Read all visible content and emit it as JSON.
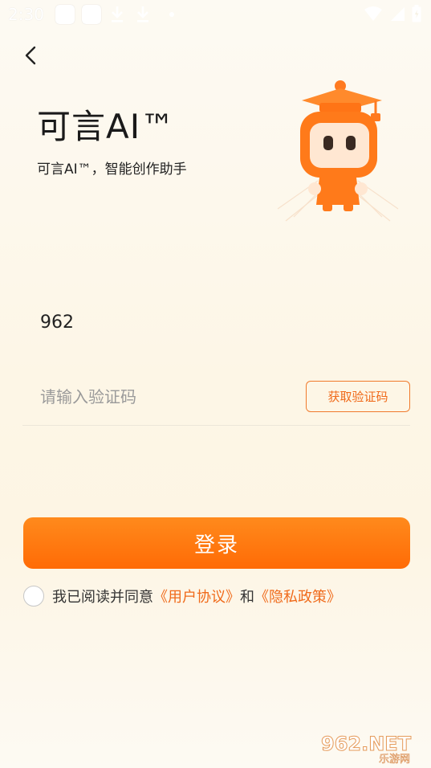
{
  "status_bar": {
    "time": "2:30"
  },
  "header": {
    "back_icon": "chevron-left-icon",
    "title": "可言AI™",
    "subtitle": "可言AI™，智能创作助手"
  },
  "form": {
    "phone_value": "962",
    "code_placeholder": "请输入验证码",
    "get_code_label": "获取验证码",
    "login_label": "登录"
  },
  "agreement": {
    "prefix": "我已阅读并同意",
    "user_agreement": "《用户协议》",
    "and": "和",
    "privacy_policy": "《隐私政策》"
  },
  "watermark": {
    "main": "962.NET",
    "sub": "乐游网"
  },
  "colors": {
    "accent": "#ff6b06",
    "accent_light": "#ff8a1c",
    "link": "#f06a1a",
    "background": "#fdf6e6"
  }
}
